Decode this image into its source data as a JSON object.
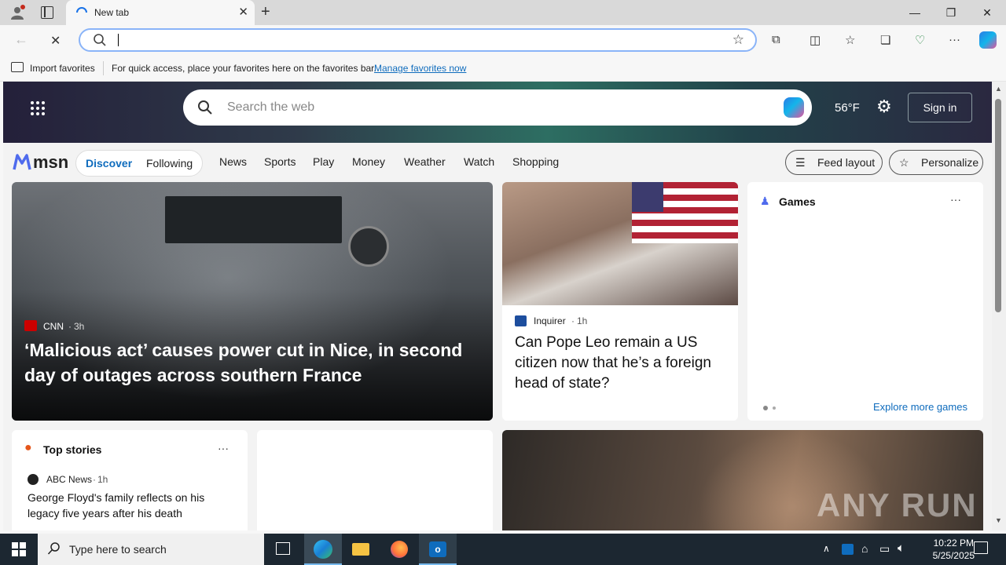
{
  "browser": {
    "tab_title": "New tab",
    "address_value": "",
    "favorites_bar": {
      "import_label": "Import favorites",
      "hint_text": "For quick access, place your favorites here on the favorites bar.",
      "manage_link": "Manage favorites now"
    }
  },
  "msn": {
    "search_placeholder": "Search the web",
    "temperature": "56°F",
    "signin_label": "Sign in",
    "logo_text": "msn",
    "feed_tabs": [
      "Discover",
      "Following"
    ],
    "nav_links": [
      "News",
      "Sports",
      "Play",
      "Money",
      "Weather",
      "Watch",
      "Shopping"
    ],
    "feed_layout_label": "Feed layout",
    "personalize_label": "Personalize",
    "hero_story": {
      "source": "CNN",
      "age": "3h",
      "headline": "‘Malicious act’ causes power cut in Nice, in second day of outages across southern France"
    },
    "side_story": {
      "source": "Inquirer",
      "age": "1h",
      "headline": "Can Pope Leo remain a US citizen now that he’s a foreign head of state?"
    },
    "games": {
      "title": "Games",
      "explore_link": "Explore more games"
    },
    "top_stories": {
      "title": "Top stories",
      "source": "ABC News",
      "age": "1h",
      "headline": "George Floyd's family reflects on his legacy five years after his death"
    },
    "watermark": "ANY RUN"
  },
  "taskbar": {
    "search_placeholder": "Type here to search",
    "time": "10:22 PM",
    "date": "5/25/2025"
  },
  "colors": {
    "accent": "#0f6cbd",
    "taskbar": "#1c2731"
  }
}
